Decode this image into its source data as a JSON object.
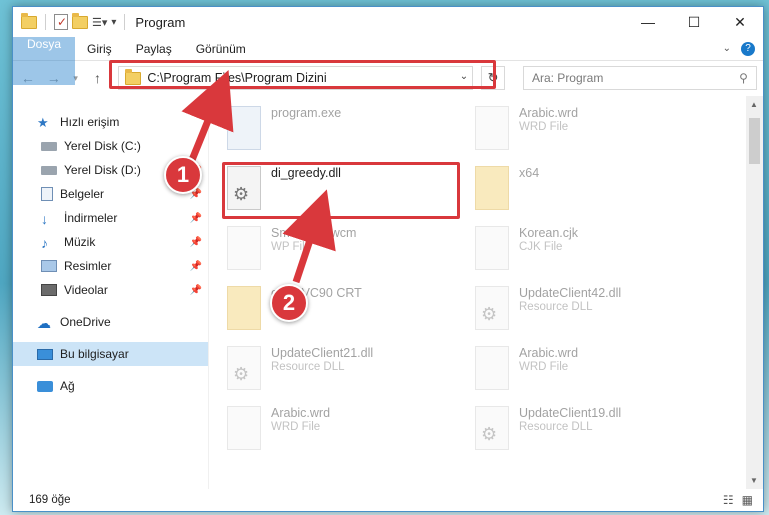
{
  "window": {
    "title": "Program"
  },
  "ribbon": {
    "tabs": [
      {
        "label": "Dosya"
      },
      {
        "label": "Giriş"
      },
      {
        "label": "Paylaş"
      },
      {
        "label": "Görünüm"
      }
    ]
  },
  "address": {
    "path": "C:\\Program Files\\Program Dizini"
  },
  "search": {
    "placeholder": "Ara: Program"
  },
  "sidebar": {
    "items": [
      {
        "label": "Hızlı erişim",
        "icon": "star-icon"
      },
      {
        "label": "Yerel Disk (C:)",
        "icon": "drive-icon"
      },
      {
        "label": "Yerel Disk (D:)",
        "icon": "drive-icon"
      },
      {
        "label": "Belgeler",
        "icon": "documents-icon"
      },
      {
        "label": "İndirmeler",
        "icon": "download-icon"
      },
      {
        "label": "Müzik",
        "icon": "music-icon"
      },
      {
        "label": "Resimler",
        "icon": "pictures-icon"
      },
      {
        "label": "Videolar",
        "icon": "videos-icon"
      },
      {
        "label": "OneDrive",
        "icon": "cloud-icon"
      },
      {
        "label": "Bu bilgisayar",
        "icon": "computer-icon"
      },
      {
        "label": "Ağ",
        "icon": "network-icon"
      }
    ]
  },
  "files": [
    {
      "name": "program.exe",
      "type": ""
    },
    {
      "name": "Arabic.wrd",
      "type": "WRD File"
    },
    {
      "name": "di_greedy.dll",
      "type": ""
    },
    {
      "name": "x64",
      "type": ""
    },
    {
      "name": "Sm  WP15.wcm",
      "type": "WP File"
    },
    {
      "name": "Korean.cjk",
      "type": "CJK File"
    },
    {
      "name": "osoft VC90 CRT",
      "type": ""
    },
    {
      "name": "UpdateClient42.dll",
      "type": "Resource DLL"
    },
    {
      "name": "UpdateClient21.dll",
      "type": "Resource DLL"
    },
    {
      "name": "Arabic.wrd",
      "type": "WRD File"
    },
    {
      "name": "Arabic.wrd",
      "type": "WRD File"
    },
    {
      "name": "UpdateClient19.dll",
      "type": "Resource DLL"
    }
  ],
  "status": {
    "count": "169 öğe"
  },
  "callouts": {
    "one": "1",
    "two": "2"
  },
  "colors": {
    "accent": "#1979ca",
    "highlight": "#d9383c",
    "selected": "#cce4f7"
  }
}
